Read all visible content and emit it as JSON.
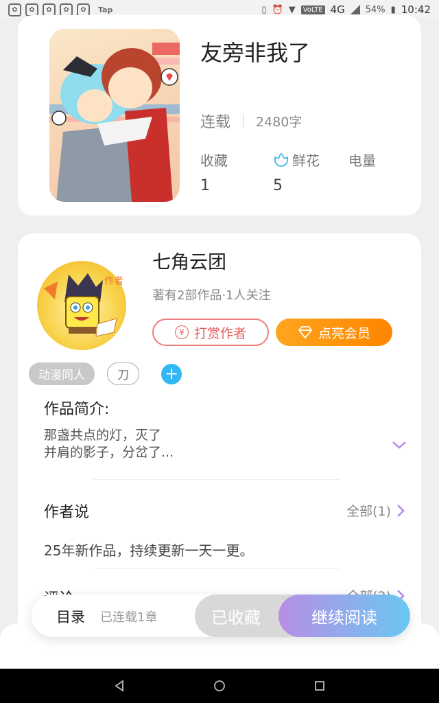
{
  "status_bar": {
    "tap_label": "Tap",
    "network": "4G",
    "lte": "VoLTE",
    "battery": "54%",
    "time": "10:42"
  },
  "book": {
    "title": "友旁非我了",
    "status": "连载",
    "word_count": "2480字",
    "stats": [
      {
        "label": "收藏",
        "value": "1"
      },
      {
        "label": "鲜花",
        "value": "5"
      },
      {
        "label": "电量",
        "value": ""
      }
    ]
  },
  "author": {
    "name": "七角云团",
    "summary": "著有2部作品·1人关注",
    "badge": "作者",
    "reward_button": "打赏作者",
    "vip_button": "点亮会员"
  },
  "tags": [
    "动漫同人",
    "刀"
  ],
  "intro": {
    "title": "作品简介:",
    "line1": "那盏共点的灯，灭了",
    "line2": "并肩的影子，分岔了..."
  },
  "author_says": {
    "title": "作者说",
    "all_label": "全部(1)",
    "text": "25年新作品，持续更新一天一更。"
  },
  "comments": {
    "title": "评论",
    "all_label": "全部(2)"
  },
  "bottom_bar": {
    "catalog": "目录",
    "chapters": "已连载1章",
    "collected": "已收藏",
    "read": "继续阅读"
  },
  "colors": {
    "accent_purple": "#b78ee6",
    "accent_blue": "#6ac7f2",
    "vip_orange": "#ff8500",
    "reward_red": "#e65b5b"
  }
}
